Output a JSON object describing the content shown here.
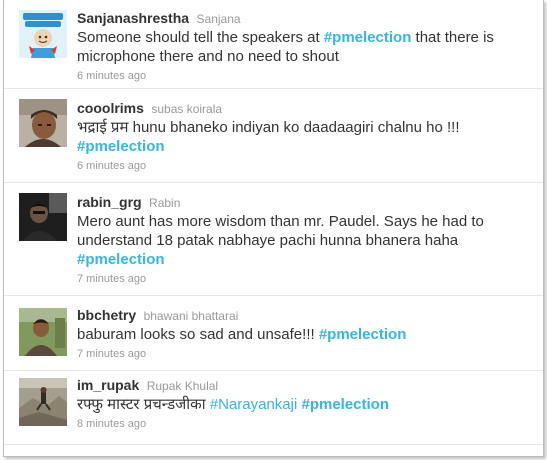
{
  "tweets": [
    {
      "username": "Sanjanashrestha",
      "fullname": "Sanjana",
      "text_before": "Someone should tell the speakers at ",
      "hashtag": "#pmelection",
      "text_after": " that there is microphone there and no need to shout",
      "time": "6 minutes ago",
      "avatar_icon": "superhero-cartoon-avatar"
    },
    {
      "username": "cooolrims",
      "fullname": "subas koirala",
      "text": "भद्राई प्रम hunu bhaneko indiyan ko daadaagiri chalnu ho !!!",
      "hashtag": "#pmelection",
      "time": "6 minutes ago",
      "avatar_icon": "man-with-cap-photo"
    },
    {
      "username": "rabin_grg",
      "fullname": "Rabin",
      "text": "Mero aunt has more wisdom than mr. Paudel. Says he had to understand 18 patak nabhaye pachi hunna bhanera haha",
      "hashtag": "#pmelection",
      "time": "7 minutes ago",
      "avatar_icon": "man-in-dark-photo"
    },
    {
      "username": "bbchetry",
      "fullname": "bhawani bhattarai",
      "text": "baburam looks so sad and unsafe!!! ",
      "hashtag": "#pmelection",
      "time": "7 minutes ago",
      "avatar_icon": "man-outdoors-photo"
    },
    {
      "username": "im_rupak",
      "fullname": "Rupak Khulal",
      "text": "रफ्फु मास्टर प्रचन्डजीका ",
      "hashtag_light": "#Narayankaji",
      "hashtag": "#pmelection",
      "time": "8 minutes ago",
      "avatar_icon": "person-on-rocks-photo"
    }
  ],
  "colors": {
    "hashtag": "#33b5e5",
    "meta": "#999999",
    "text": "#333333"
  }
}
